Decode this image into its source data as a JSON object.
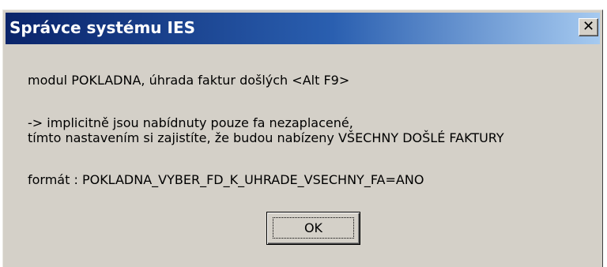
{
  "window": {
    "title": "Správce systému IES",
    "close_glyph": "✕"
  },
  "message": {
    "line1": "modul POKLADNA, úhrada faktur došlých <Alt F9>",
    "line2": "-> implicitně jsou nabídnuty pouze fa nezaplacené,",
    "line3": "tímto nastavením si zajistíte, že budou nabízeny VŠECHNY DOŠLÉ FAKTURY",
    "line4": "formát : POKLADNA_VYBER_FD_K_UHRADE_VSECHNY_FA=ANO"
  },
  "buttons": {
    "ok_label": "OK"
  }
}
